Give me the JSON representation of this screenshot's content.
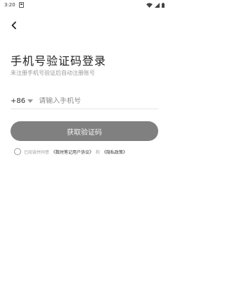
{
  "status_bar": {
    "time": "3:20"
  },
  "header": {
    "title": "手机号验证码登录",
    "subtitle": "未注册手机号验证后自动注册账号"
  },
  "phone": {
    "country_code": "+86",
    "placeholder": "请输入手机号",
    "value": ""
  },
  "actions": {
    "get_code_label": "获取验证码",
    "button_color": "#808080"
  },
  "agreement": {
    "prefix": "已阅读并同意",
    "user_agreement": "《数时笔记用户协议》",
    "and": "和",
    "privacy_policy": "《隐私政策》",
    "checked": false
  },
  "icons": {
    "back": "back-arrow-icon",
    "dropdown": "triangle-down-icon",
    "wifi": "wifi-icon",
    "signal": "signal-icon",
    "battery": "battery-icon",
    "sim": "sim-card-icon"
  }
}
